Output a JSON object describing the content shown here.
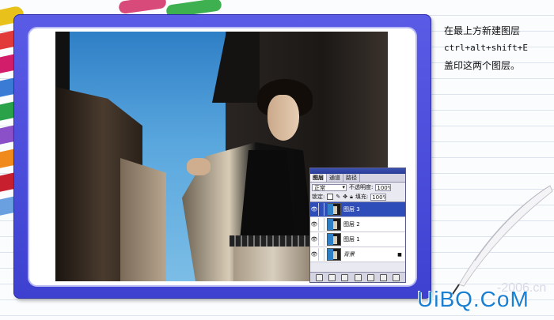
{
  "instructions": {
    "line1": "在最上方新建图层",
    "line2": "ctrl+alt+shift+E",
    "line3": "盖印这两个图层。"
  },
  "layers_panel": {
    "tabs": [
      "图层",
      "通道",
      "路径"
    ],
    "active_tab": "图层",
    "blend_mode": "正常",
    "opacity_label": "不透明度:",
    "opacity_value": "100%",
    "lock_label": "锁定:",
    "fill_label": "填充:",
    "fill_value": "100%",
    "layers": [
      {
        "name": "图层 3",
        "selected": true,
        "visible": true,
        "locked": false
      },
      {
        "name": "图层 2",
        "selected": false,
        "visible": true,
        "locked": false
      },
      {
        "name": "图层 1",
        "selected": false,
        "visible": true,
        "locked": false
      },
      {
        "name": "背景",
        "selected": false,
        "visible": true,
        "locked": true
      }
    ]
  },
  "watermark": {
    "faint": "-2006.cn",
    "brand": "UiBQ.CoM"
  },
  "colors": {
    "frame": "#4446d6",
    "selected_layer": "#2f4db8",
    "brand": "#1a7fd1"
  },
  "icons": [
    "eye-icon",
    "lock-icon",
    "brush-icon",
    "quill-icon",
    "pencil-icon"
  ]
}
